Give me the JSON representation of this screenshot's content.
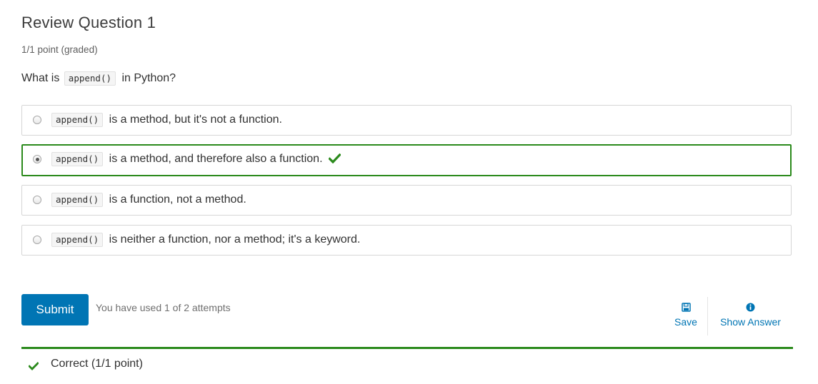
{
  "question": {
    "title": "Review Question 1",
    "points": "1/1 point (graded)",
    "prompt_before": "What is",
    "prompt_code": "append()",
    "prompt_after": "in Python?"
  },
  "choices": [
    {
      "code": "append()",
      "text": "is a method, but it's not a function.",
      "selected": false,
      "correct": false
    },
    {
      "code": "append()",
      "text": "is a method, and therefore also a function.",
      "selected": true,
      "correct": true
    },
    {
      "code": "append()",
      "text": "is a function, not a method.",
      "selected": false,
      "correct": false
    },
    {
      "code": "append()",
      "text": "is neither a function, nor a method; it's a keyword.",
      "selected": false,
      "correct": false
    }
  ],
  "actions": {
    "submit_label": "Submit",
    "attempts_text": "You have used 1 of 2 attempts",
    "save_label": "Save",
    "show_answer_label": "Show Answer"
  },
  "feedback": {
    "text": "Correct (1/1 point)",
    "icon": "check-icon"
  },
  "colors": {
    "correct_green": "#2b8a1c",
    "primary_blue": "#0075b4"
  }
}
